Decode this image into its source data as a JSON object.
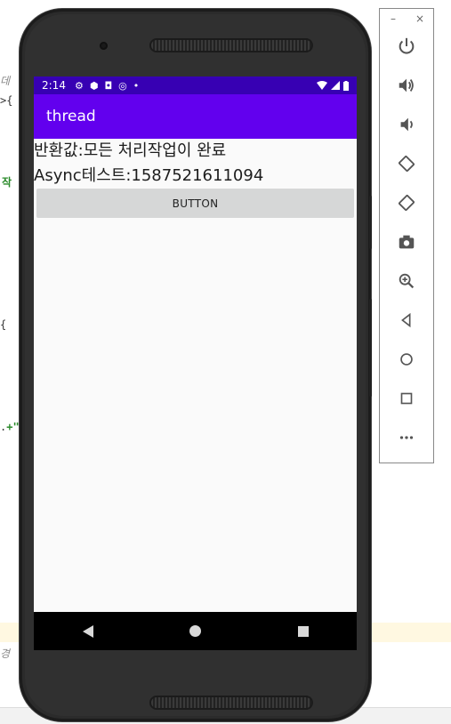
{
  "ide": {
    "frag1": "데",
    "frag2": ">{",
    "frag3": "작",
    "frag4": "{",
    "frag5": "+\"",
    "frag6": "경"
  },
  "phone": {
    "status": {
      "time": "2:14",
      "icons": [
        "gear-icon",
        "shield-icon",
        "a-icon",
        "at-icon",
        "dot-icon"
      ],
      "right_icons": [
        "wifi-icon",
        "signal-icon",
        "battery-icon"
      ]
    },
    "app_title": "thread",
    "line1": "반환값:모든 처리작업이 완료",
    "line2": "Async테스트:1587521611094",
    "button_label": "BUTTON",
    "nav": [
      "back-icon",
      "home-icon",
      "recents-icon"
    ]
  },
  "toolbar": {
    "minimize": "–",
    "close": "×",
    "items": [
      "power",
      "volume-up",
      "volume-down",
      "rotate-left",
      "rotate-right",
      "screenshot",
      "zoom",
      "back",
      "home",
      "overview",
      "more"
    ]
  },
  "colors": {
    "status_bar": "#3700b3",
    "app_bar": "#6200ee",
    "button": "#d6d7d7"
  }
}
